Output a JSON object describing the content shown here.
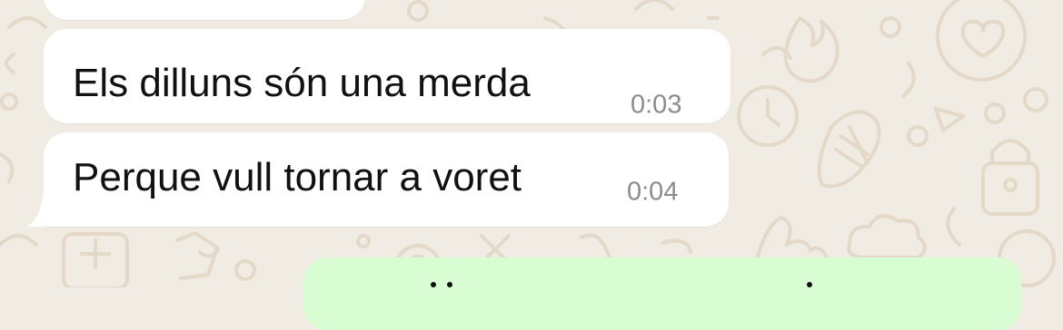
{
  "chat": {
    "messages": [
      {
        "direction": "incoming",
        "text": "Els dilluns són una merda",
        "time": "0:03"
      },
      {
        "direction": "incoming",
        "text": "Perque vull tornar a voret",
        "time": "0:04"
      }
    ]
  },
  "colors": {
    "wallpaper_bg": "#f1ece3",
    "incoming_bubble": "#ffffff",
    "outgoing_bubble": "#d9fdd3",
    "message_text": "#111111",
    "timestamp_text": "#8c8c8c"
  }
}
